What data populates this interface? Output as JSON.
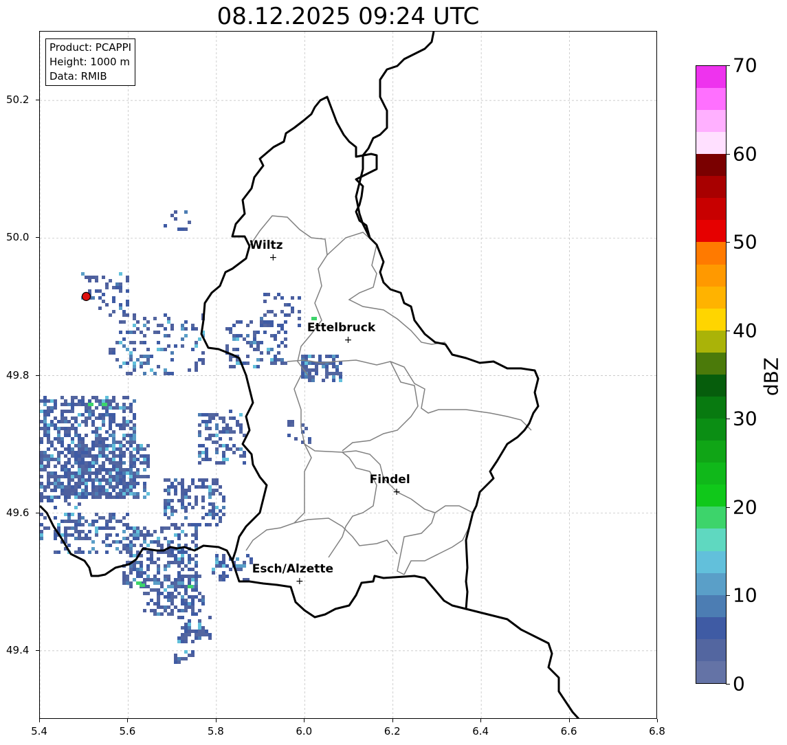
{
  "title": "08.12.2025 09:24 UTC",
  "info": {
    "product": "Product: PCAPPI",
    "height": "Height: 1000 m",
    "data": "Data: RMIB"
  },
  "map": {
    "lon_range": [
      5.4,
      6.8
    ],
    "lat_range": [
      49.3,
      50.3
    ],
    "x_ticks": [
      "5.4",
      "5.6",
      "5.8",
      "6.0",
      "6.2",
      "6.4",
      "6.6",
      "6.8"
    ],
    "y_ticks": [
      "49.4",
      "49.6",
      "49.8",
      "50.0",
      "50.2"
    ],
    "grid": true,
    "cities": [
      {
        "name": "Wiltz",
        "lon": 5.93,
        "lat": 49.97
      },
      {
        "name": "Ettelbruck",
        "lon": 6.1,
        "lat": 49.85
      },
      {
        "name": "Findel",
        "lon": 6.21,
        "lat": 49.63
      },
      {
        "name": "Esch/Alzette",
        "lon": 5.99,
        "lat": 49.5
      }
    ],
    "radar_site": {
      "lon": 5.505,
      "lat": 49.915,
      "color": "#dd1111"
    },
    "border_color": "#000000",
    "canton_color": "#808080"
  },
  "colorbar": {
    "label": "dBZ",
    "min": 0,
    "max": 70,
    "ticks": [
      "0",
      "10",
      "20",
      "30",
      "40",
      "50",
      "60",
      "70"
    ],
    "colors": [
      "#6473a6",
      "#5366a0",
      "#3f5ba4",
      "#4c7db3",
      "#5a9fc8",
      "#62c0db",
      "#5fd8c0",
      "#3dd46b",
      "#10c81a",
      "#10b81a",
      "#10a516",
      "#0b8e14",
      "#087a10",
      "#065d0c",
      "#4b7a0a",
      "#aab308",
      "#ffd500",
      "#ffb300",
      "#ff9900",
      "#ff7a00",
      "#e60000",
      "#c80000",
      "#a80000",
      "#7a0000",
      "#ffe0ff",
      "#ffb0ff",
      "#ff70ff",
      "#ee33ee"
    ]
  }
}
